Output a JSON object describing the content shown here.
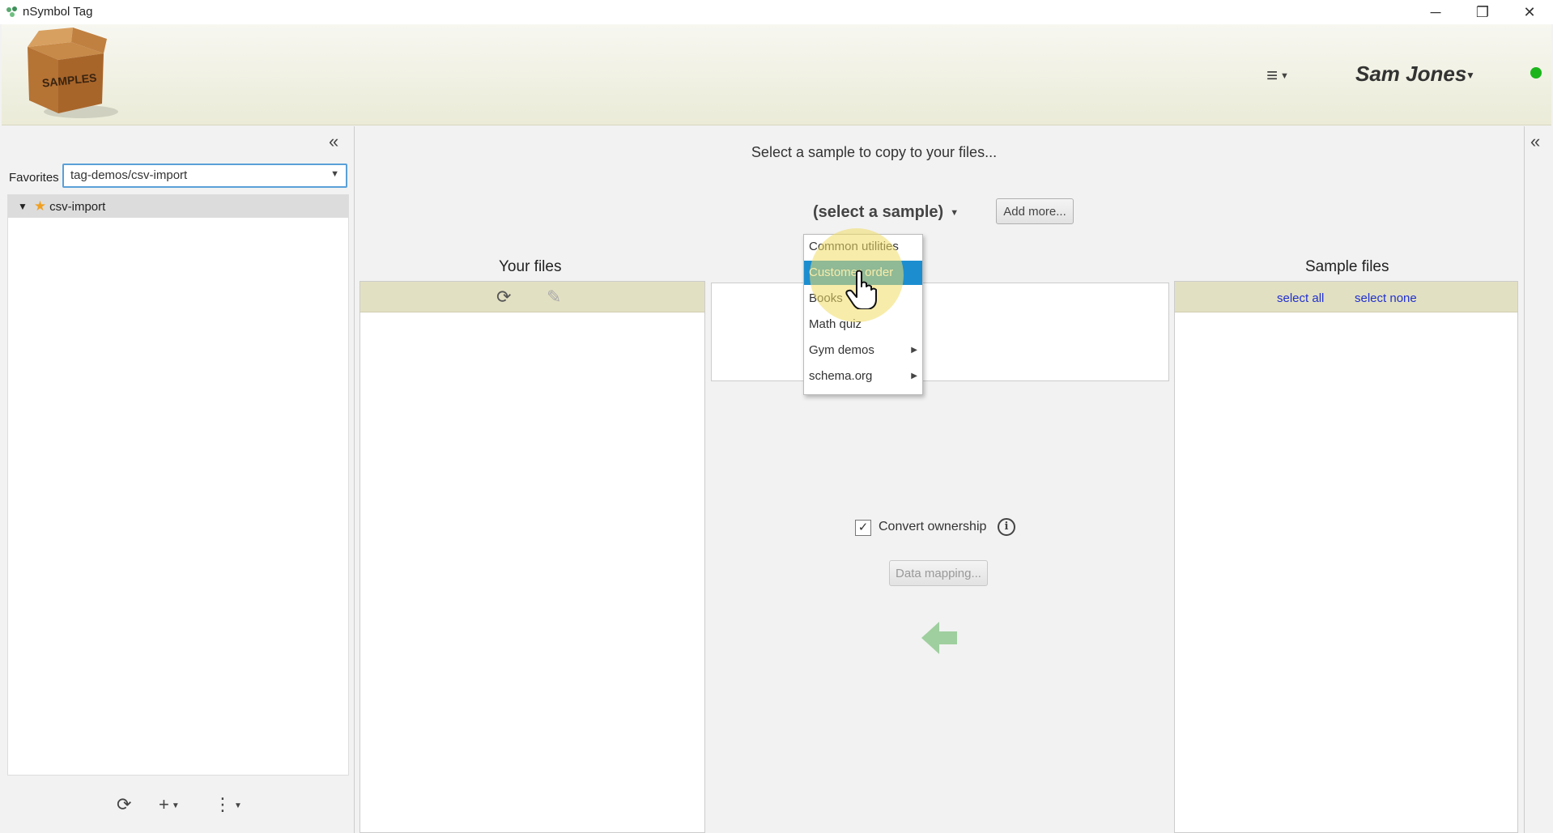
{
  "window": {
    "title": "nSymbol Tag",
    "minimize_glyph": "─",
    "restore_glyph": "❐",
    "close_glyph": "✕"
  },
  "header": {
    "logo_text": "SAMPLES",
    "menu_glyph": "≡",
    "user_name": "Sam Jones",
    "status_color": "#1bb51b"
  },
  "left_panel": {
    "collapse_glyph": "«",
    "favorites_label": "Favorites",
    "favorites_value": "tag-demos/csv-import",
    "tree": [
      {
        "label": "csv-import",
        "icon": "star-icon",
        "expanded": true
      }
    ],
    "footer": {
      "refresh_glyph": "⟳",
      "add_glyph": "+",
      "more_glyph": "⋮"
    }
  },
  "main": {
    "prompt": "Select a sample to copy to your files...",
    "sample_select_label": "(select a sample)",
    "add_more_label": "Add more...",
    "your_files_title": "Your files",
    "sample_files_title": "Sample files",
    "select_all_label": "select all",
    "select_none_label": "select none",
    "convert_ownership_label": "Convert ownership",
    "convert_ownership_checked": true,
    "data_mapping_label": "Data mapping...",
    "refresh_glyph": "⟳",
    "edit_glyph": "✎"
  },
  "right_panel": {
    "collapse_glyph": "«"
  },
  "dropdown": {
    "items": [
      {
        "label": "Common utilities",
        "has_submenu": false
      },
      {
        "label": "Customer order",
        "has_submenu": false,
        "selected": true
      },
      {
        "label": "Books",
        "has_submenu": false
      },
      {
        "label": "Math quiz",
        "has_submenu": false
      },
      {
        "label": "Gym demos",
        "has_submenu": true
      },
      {
        "label": "schema.org",
        "has_submenu": true
      }
    ]
  }
}
